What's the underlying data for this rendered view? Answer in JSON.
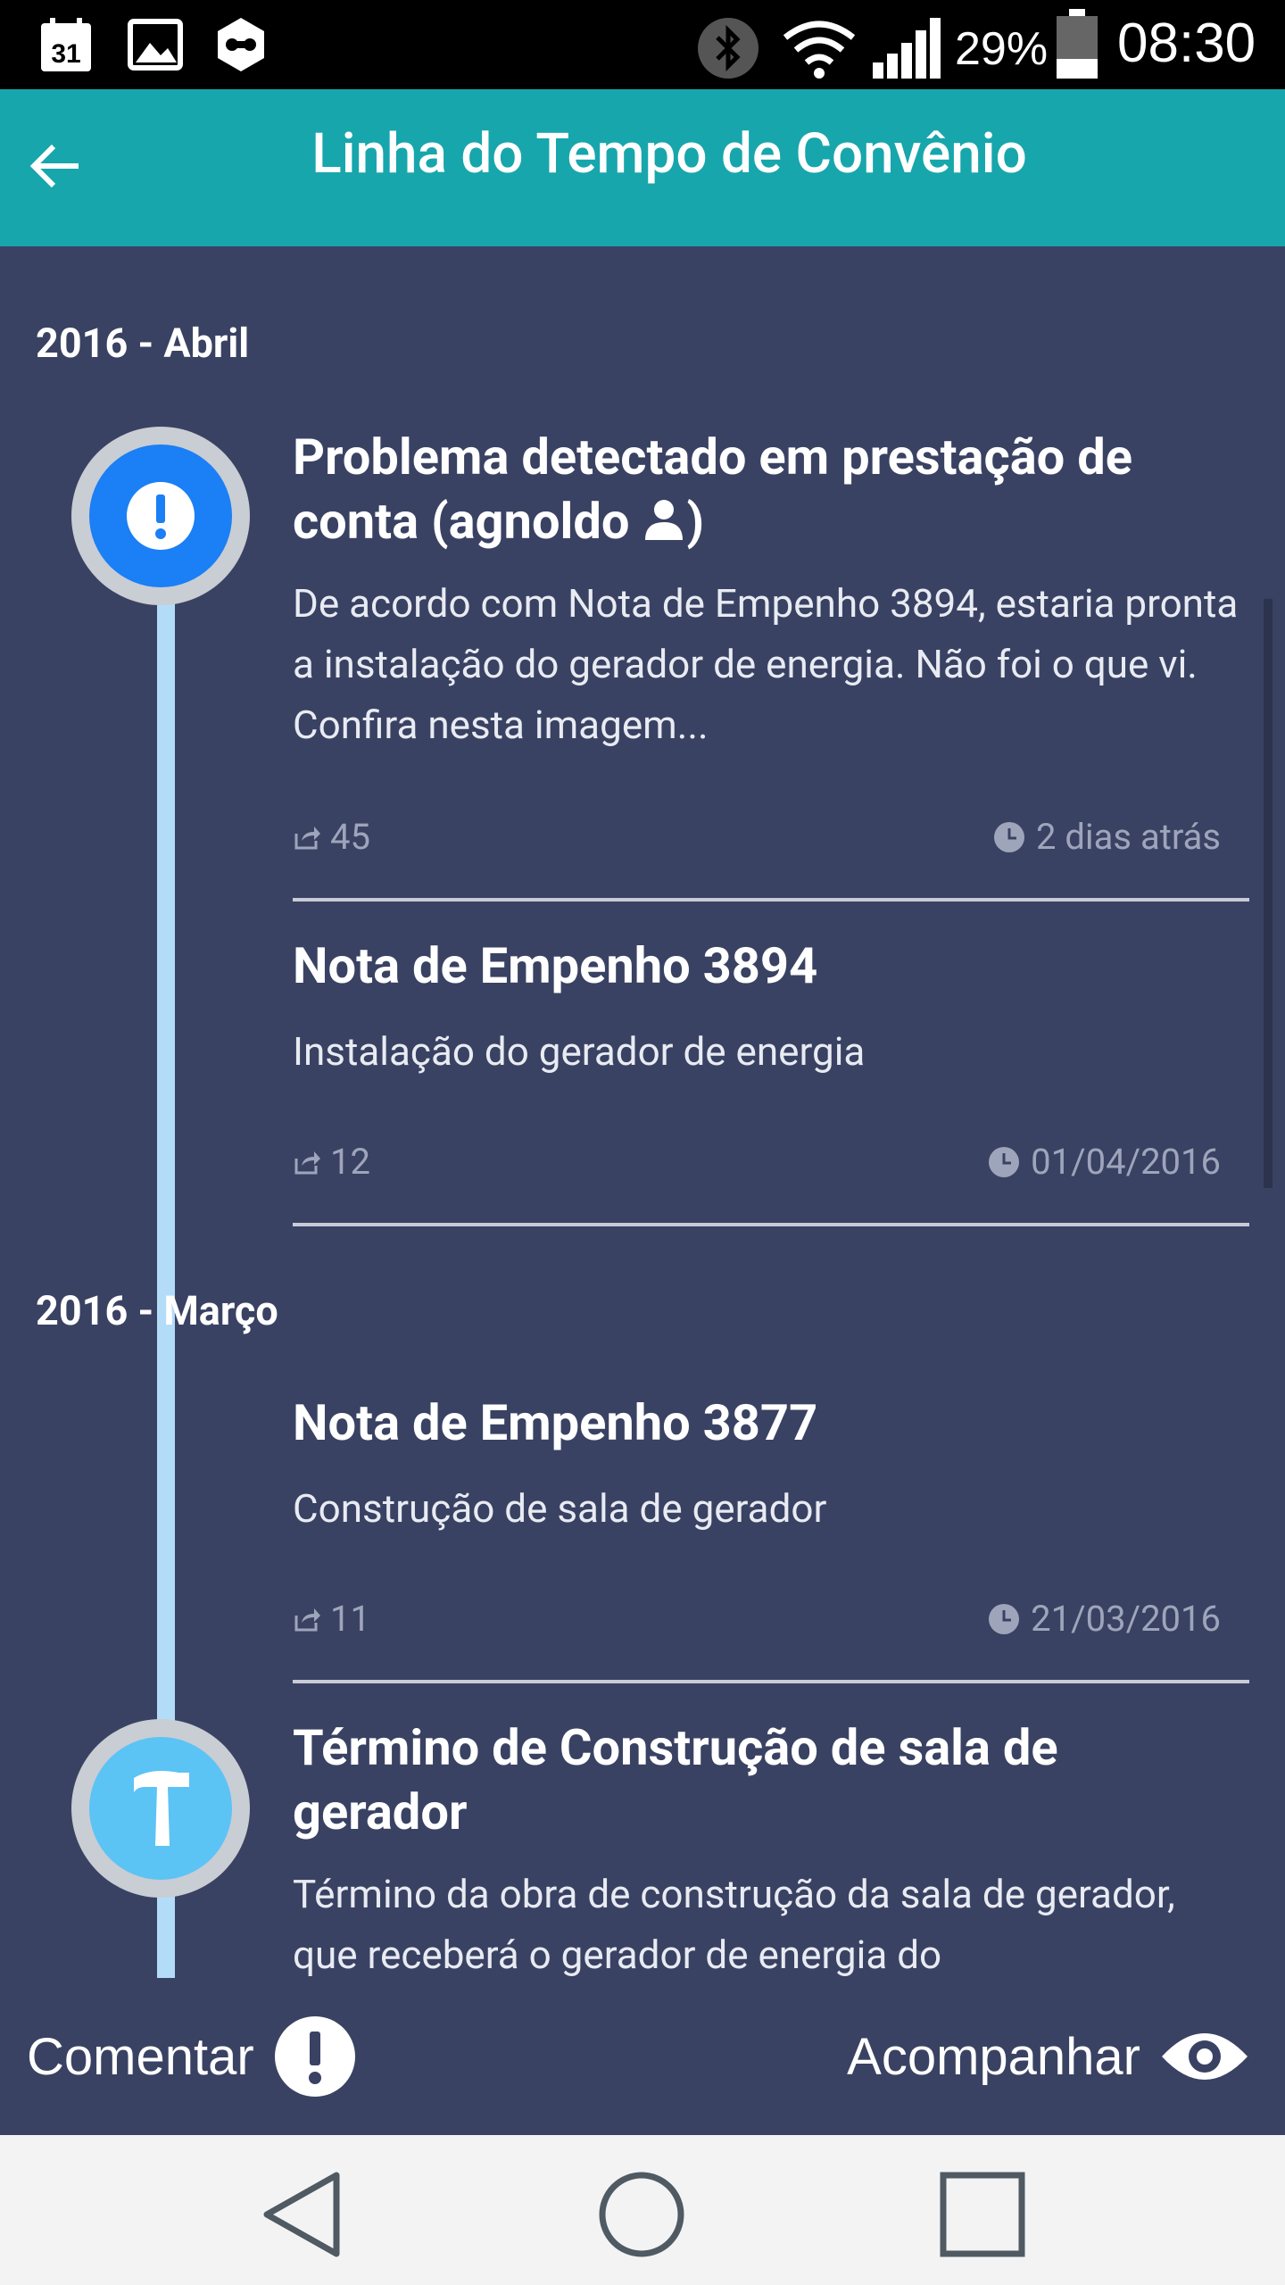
{
  "status_bar": {
    "calendar_day": "31",
    "battery_percent": "29%",
    "time": "08:30"
  },
  "app_bar": {
    "title": "Linha do Tempo de Convênio"
  },
  "timeline": {
    "groups": [
      {
        "month": "2016 - Abril",
        "entries": [
          {
            "title_line1": "Problema detectado em prestação de",
            "title_line2": "conta (agnoldo",
            "title_suffix": ")",
            "body": "De acordo com Nota de Empenho 3894, estaria pronta a instalação do gerador de energia. Não foi o que vi. Confira nesta imagem...",
            "shares": "45",
            "time": "2 dias atrás",
            "node_icon": "exclamation-icon"
          },
          {
            "title": "Nota de Empenho 3894",
            "body": "Instalação do gerador de energia",
            "shares": "12",
            "time": "01/04/2016"
          }
        ]
      },
      {
        "month": "2016 - Março",
        "entries": [
          {
            "title": "Nota de Empenho 3877",
            "body": "Construção de sala de gerador",
            "shares": "11",
            "time": "21/03/2016"
          },
          {
            "title": "Término de Construção de sala de gerador",
            "body": "Término da obra de construção da sala de gerador, que receberá o gerador de energia do",
            "node_icon": "hammer-icon"
          }
        ]
      }
    ]
  },
  "actions": {
    "comment_label": "Comentar",
    "follow_label": "Acompanhar"
  },
  "colors": {
    "app_bar": "#17a6ac",
    "background": "#3a4263",
    "timeline_line": "#b3dcf9",
    "alert_node": "#1b7ff5",
    "hammer_node": "#5cc3f5"
  }
}
